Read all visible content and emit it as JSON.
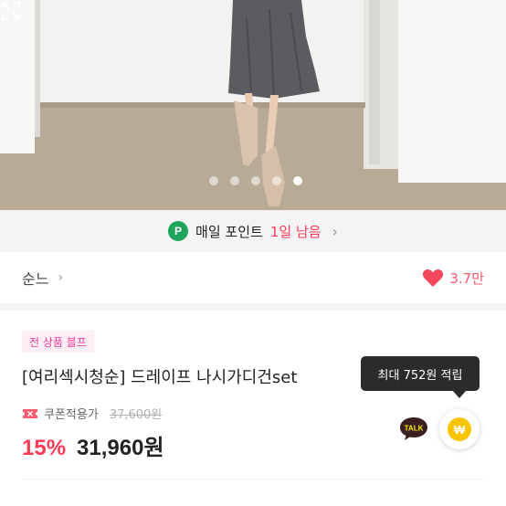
{
  "gallery": {
    "slide_count": 5,
    "active_index": 4,
    "expand_icon": "expand-icon"
  },
  "point_banner": {
    "icon_letter": "P",
    "text": "매일 포인트",
    "highlight": "1일 남음",
    "chevron": "›",
    "accent_color": "#1ea55b",
    "highlight_color": "#ff3b56"
  },
  "shop": {
    "name": "순느",
    "chevron": "›",
    "like_icon": "heart-icon",
    "like_count": "3.7만"
  },
  "product": {
    "badge": "전 상품 블프",
    "title": "[여리섹시청순] 드레이프 나시가디건set",
    "coupon_label": "쿠폰적용가",
    "original_price": "37,600원",
    "discount": "15%",
    "price": "31,960원"
  },
  "reward": {
    "tooltip": "최대 752원 적립",
    "talk_label": "TALK",
    "won_symbol": "₩"
  },
  "next_row": {
    "left": "",
    "right": ""
  }
}
